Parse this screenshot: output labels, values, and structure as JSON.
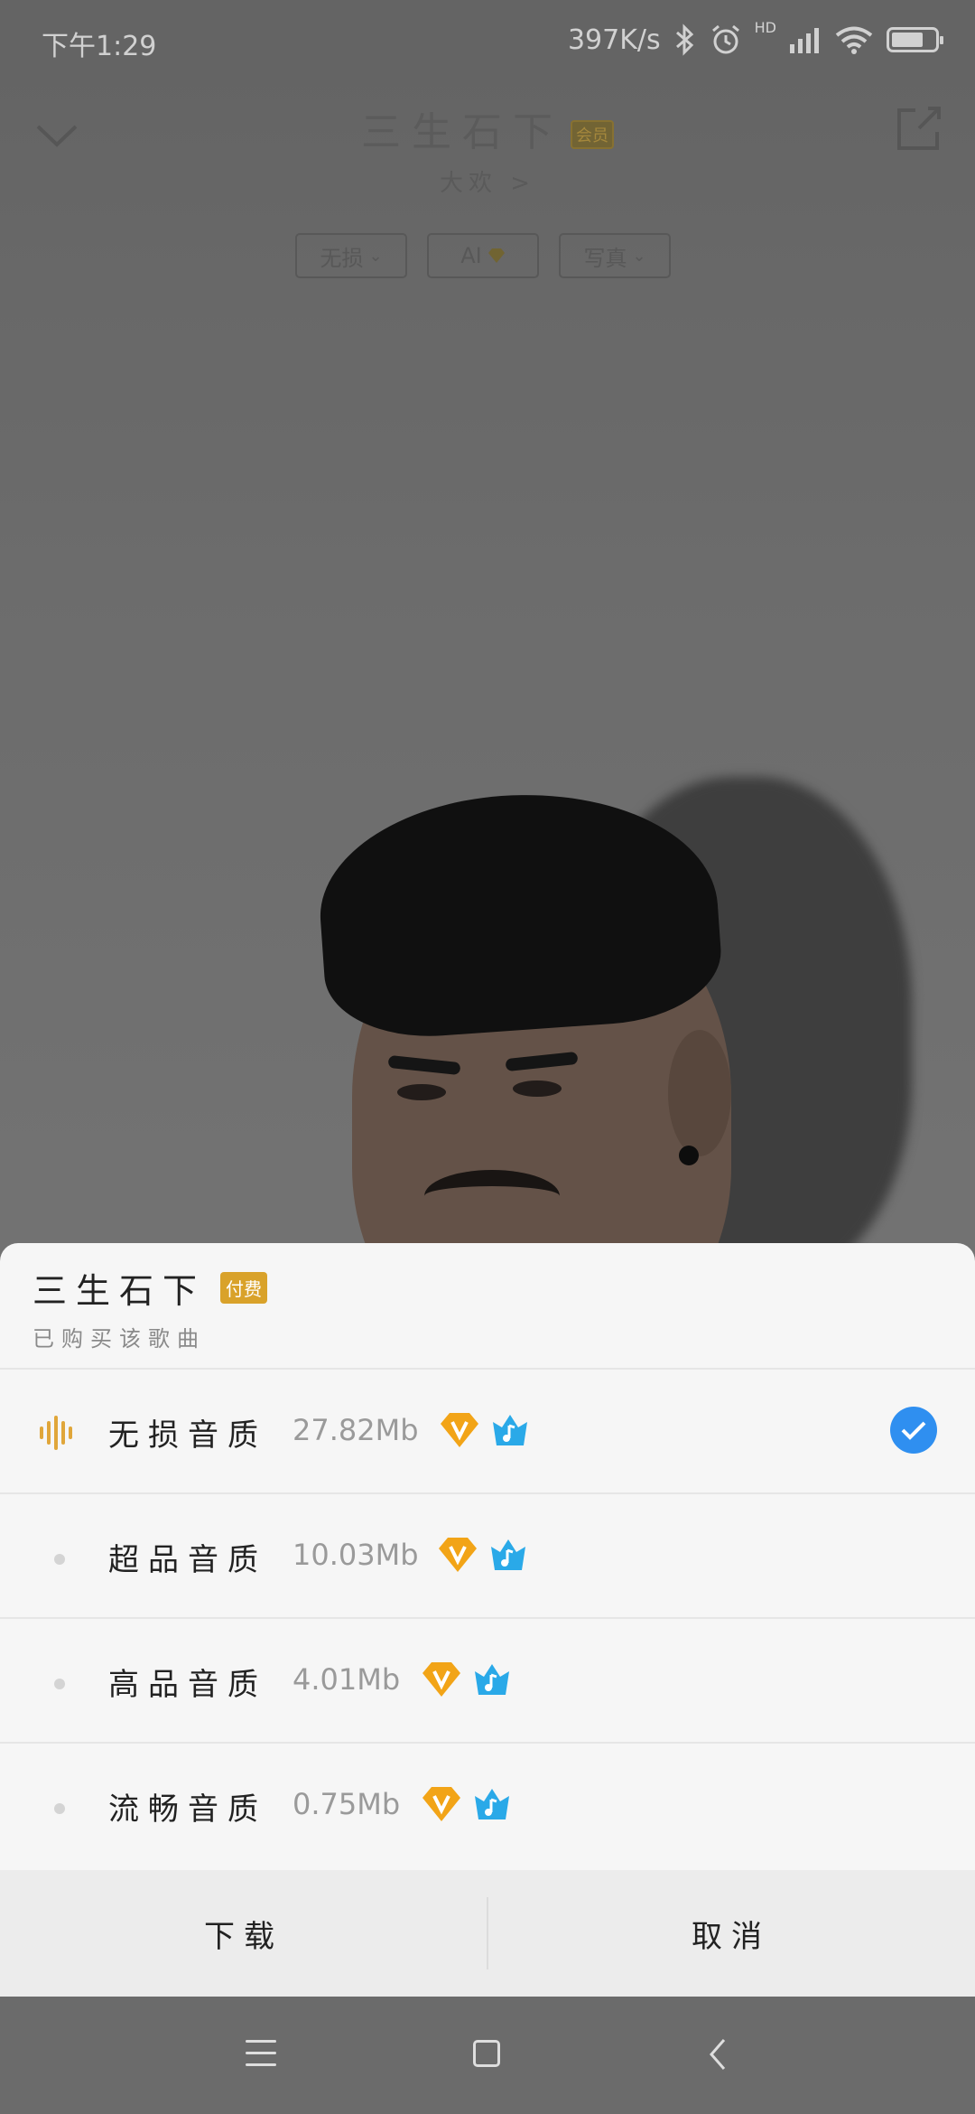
{
  "status_bar": {
    "time": "下午1:29",
    "network_speed": "397K/s",
    "hd": "HD",
    "icons": [
      "bluetooth-icon",
      "alarm-icon",
      "signal-icon",
      "wifi-icon",
      "battery-icon"
    ]
  },
  "player": {
    "title": "三生石下",
    "vip_tag": "会员",
    "artist": "大欢 >",
    "modes": [
      {
        "label": "无损",
        "has_chevron": true
      },
      {
        "label": "AI",
        "has_chevron": false
      },
      {
        "label": "写真",
        "has_chevron": true
      }
    ]
  },
  "sheet": {
    "title": "三生石下",
    "paid_tag": "付费",
    "subtitle": "已购买该歌曲",
    "qualities": [
      {
        "label": "无损音质",
        "size": "27.82Mb",
        "selected": true
      },
      {
        "label": "超品音质",
        "size": "10.03Mb",
        "selected": false
      },
      {
        "label": "高品音质",
        "size": "4.01Mb",
        "selected": false
      },
      {
        "label": "流畅音质",
        "size": "0.75Mb",
        "selected": false
      }
    ],
    "download_label": "下载",
    "cancel_label": "取消"
  },
  "colors": {
    "accent_blue": "#2f8ff0",
    "paid_tag": "#d9a22a",
    "wave_icon": "#e0a63a",
    "vip_gold": "#f2a417",
    "music_blue": "#2aa9e8"
  }
}
